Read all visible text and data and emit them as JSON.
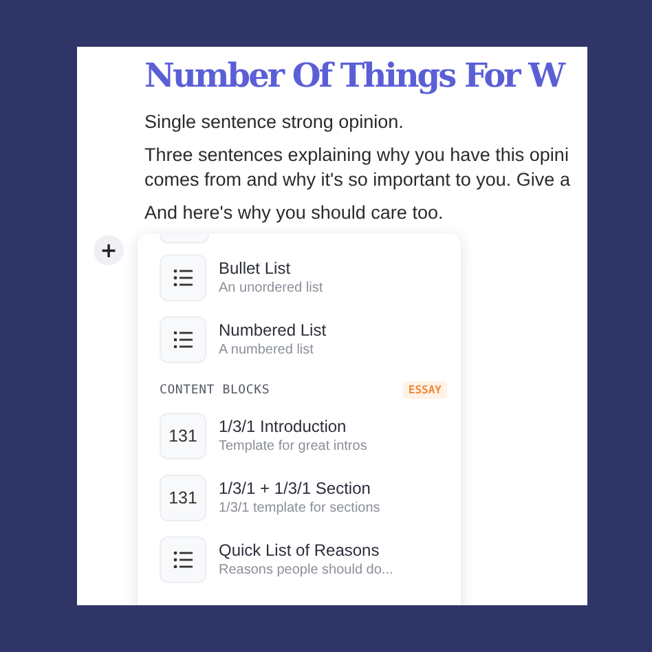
{
  "document": {
    "title": "Number Of Things For W",
    "paragraphs": [
      "Single sentence strong opinion.",
      "Three sentences explaining why you have this opini\ncomes from and why it's so important to you. Give a",
      "And here's why you should care too."
    ]
  },
  "add_button": {
    "label": "+"
  },
  "menu": {
    "items": [
      {
        "kind": "bullet",
        "title": "Bullet List",
        "subtitle": "An unordered list"
      },
      {
        "kind": "numbered",
        "title": "Numbered List",
        "subtitle": "A numbered list"
      }
    ],
    "section": {
      "heading": "CONTENT BLOCKS",
      "badge": "ESSAY",
      "items": [
        {
          "kind": "text",
          "icon_text": "131",
          "title": "1/3/1 Introduction",
          "subtitle": "Template for great intros"
        },
        {
          "kind": "text",
          "icon_text": "131",
          "title": "1/3/1 + 1/3/1 Section",
          "subtitle": "1/3/1 template for sections"
        },
        {
          "kind": "bullet",
          "title": "Quick List of Reasons",
          "subtitle": "Reasons people should do..."
        }
      ]
    }
  }
}
